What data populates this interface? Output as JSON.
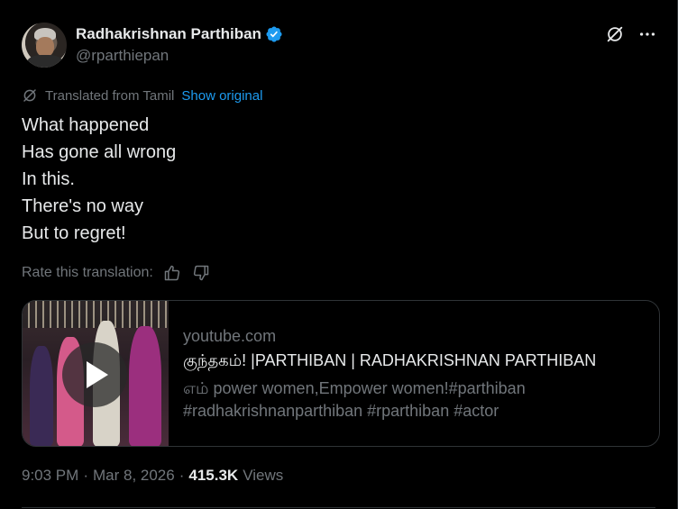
{
  "author": {
    "display_name": "Radhakrishnan Parthiban",
    "handle": "@rparthiepan",
    "verified_color": "#1d9bf0"
  },
  "header": {
    "icons": [
      "grok-icon",
      "more-icon"
    ]
  },
  "translation": {
    "note": "Translated from Tamil",
    "show_original": "Show original",
    "rate_label": "Rate this translation:"
  },
  "tweet": {
    "lines": [
      "What happened",
      "Has gone all wrong",
      "In this.",
      "There's no way",
      "But to regret!"
    ]
  },
  "card": {
    "domain": "youtube.com",
    "title": "குந்தகம்! |PARTHIBAN | RADHAKRISHNAN PARTHIBAN",
    "description": "எம் power women,Empower women!#parthiban #radhakrishnanparthiban #rparthiban #actor"
  },
  "meta": {
    "time": "9:03 PM",
    "sep": "·",
    "date": "Mar 8, 2026",
    "sep2": "·",
    "views_count": "415.3K",
    "views_label": "Views"
  },
  "colors": {
    "background": "#000000",
    "text": "#e7e9ea",
    "muted": "#71767b",
    "link": "#1d9bf0",
    "border": "#2f3336"
  }
}
